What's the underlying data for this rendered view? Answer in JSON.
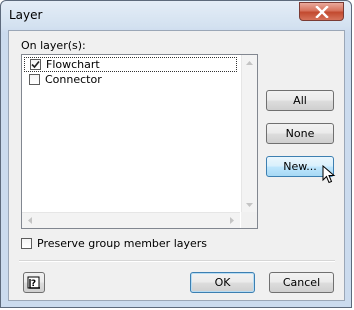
{
  "window": {
    "title": "Layer",
    "close_label": "x"
  },
  "layers": {
    "label": "On layer(s):",
    "items": [
      {
        "name": "Flowchart",
        "checked": true,
        "focused": true
      },
      {
        "name": "Connector",
        "checked": false,
        "focused": false
      }
    ]
  },
  "side_buttons": {
    "all": "All",
    "none": "None",
    "new": "New..."
  },
  "preserve": {
    "label": "Preserve group member layers",
    "checked": false
  },
  "footer": {
    "ok": "OK",
    "cancel": "Cancel",
    "help_icon": "question-mark-icon"
  },
  "colors": {
    "title_bar": "#d3e1f0",
    "close_button": "#c24a2f",
    "hover_button": "#bee6fd"
  }
}
